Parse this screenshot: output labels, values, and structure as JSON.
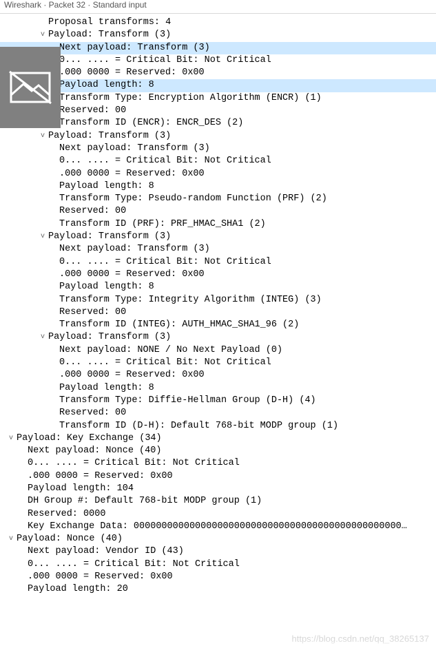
{
  "window": {
    "title": "Wireshark · Packet 32 · Standard input"
  },
  "watermark": "https://blog.csdn.net/qq_38265137",
  "rows": [
    {
      "indent": 56,
      "toggle": "",
      "sel": false,
      "text": "Proposal transforms: 4"
    },
    {
      "indent": 56,
      "toggle": "v",
      "sel": false,
      "text": "Payload: Transform (3)"
    },
    {
      "indent": 72,
      "toggle": "",
      "sel": true,
      "text": "Next payload: Transform (3)"
    },
    {
      "indent": 72,
      "toggle": "",
      "sel": false,
      "text": "0... .... = Critical Bit: Not Critical"
    },
    {
      "indent": 72,
      "toggle": "",
      "sel": false,
      "text": ".000 0000 = Reserved: 0x00"
    },
    {
      "indent": 72,
      "toggle": "",
      "sel": true,
      "text": "Payload length: 8"
    },
    {
      "indent": 72,
      "toggle": "",
      "sel": false,
      "text": "Transform Type: Encryption Algorithm (ENCR) (1)"
    },
    {
      "indent": 72,
      "toggle": "",
      "sel": false,
      "text": "Reserved: 00"
    },
    {
      "indent": 72,
      "toggle": "",
      "sel": false,
      "text": "Transform ID (ENCR): ENCR_DES (2)"
    },
    {
      "indent": 56,
      "toggle": "v",
      "sel": false,
      "text": "Payload: Transform (3)"
    },
    {
      "indent": 72,
      "toggle": "",
      "sel": false,
      "text": "Next payload: Transform (3)"
    },
    {
      "indent": 72,
      "toggle": "",
      "sel": false,
      "text": "0... .... = Critical Bit: Not Critical"
    },
    {
      "indent": 72,
      "toggle": "",
      "sel": false,
      "text": ".000 0000 = Reserved: 0x00"
    },
    {
      "indent": 72,
      "toggle": "",
      "sel": false,
      "text": "Payload length: 8"
    },
    {
      "indent": 72,
      "toggle": "",
      "sel": false,
      "text": "Transform Type: Pseudo-random Function (PRF) (2)"
    },
    {
      "indent": 72,
      "toggle": "",
      "sel": false,
      "text": "Reserved: 00"
    },
    {
      "indent": 72,
      "toggle": "",
      "sel": false,
      "text": "Transform ID (PRF): PRF_HMAC_SHA1 (2)"
    },
    {
      "indent": 56,
      "toggle": "v",
      "sel": false,
      "text": "Payload: Transform (3)"
    },
    {
      "indent": 72,
      "toggle": "",
      "sel": false,
      "text": "Next payload: Transform (3)"
    },
    {
      "indent": 72,
      "toggle": "",
      "sel": false,
      "text": "0... .... = Critical Bit: Not Critical"
    },
    {
      "indent": 72,
      "toggle": "",
      "sel": false,
      "text": ".000 0000 = Reserved: 0x00"
    },
    {
      "indent": 72,
      "toggle": "",
      "sel": false,
      "text": "Payload length: 8"
    },
    {
      "indent": 72,
      "toggle": "",
      "sel": false,
      "text": "Transform Type: Integrity Algorithm (INTEG) (3)"
    },
    {
      "indent": 72,
      "toggle": "",
      "sel": false,
      "text": "Reserved: 00"
    },
    {
      "indent": 72,
      "toggle": "",
      "sel": false,
      "text": "Transform ID (INTEG): AUTH_HMAC_SHA1_96 (2)"
    },
    {
      "indent": 56,
      "toggle": "v",
      "sel": false,
      "text": "Payload: Transform (3)"
    },
    {
      "indent": 72,
      "toggle": "",
      "sel": false,
      "text": "Next payload: NONE / No Next Payload  (0)"
    },
    {
      "indent": 72,
      "toggle": "",
      "sel": false,
      "text": "0... .... = Critical Bit: Not Critical"
    },
    {
      "indent": 72,
      "toggle": "",
      "sel": false,
      "text": ".000 0000 = Reserved: 0x00"
    },
    {
      "indent": 72,
      "toggle": "",
      "sel": false,
      "text": "Payload length: 8"
    },
    {
      "indent": 72,
      "toggle": "",
      "sel": false,
      "text": "Transform Type: Diffie-Hellman Group (D-H) (4)"
    },
    {
      "indent": 72,
      "toggle": "",
      "sel": false,
      "text": "Reserved: 00"
    },
    {
      "indent": 72,
      "toggle": "",
      "sel": false,
      "text": "Transform ID (D-H): Default 768-bit MODP group (1)"
    },
    {
      "indent": 10,
      "toggle": "v",
      "sel": false,
      "text": "Payload: Key Exchange (34)"
    },
    {
      "indent": 26,
      "toggle": "",
      "sel": false,
      "text": "Next payload: Nonce (40)"
    },
    {
      "indent": 26,
      "toggle": "",
      "sel": false,
      "text": "0... .... = Critical Bit: Not Critical"
    },
    {
      "indent": 26,
      "toggle": "",
      "sel": false,
      "text": ".000 0000 = Reserved: 0x00"
    },
    {
      "indent": 26,
      "toggle": "",
      "sel": false,
      "text": "Payload length: 104"
    },
    {
      "indent": 26,
      "toggle": "",
      "sel": false,
      "text": "DH Group #: Default 768-bit MODP group (1)"
    },
    {
      "indent": 26,
      "toggle": "",
      "sel": false,
      "text": "Reserved: 0000"
    },
    {
      "indent": 26,
      "toggle": "",
      "sel": false,
      "text": "Key Exchange Data: 000000000000000000000000000000000000000000000000…"
    },
    {
      "indent": 10,
      "toggle": "v",
      "sel": false,
      "text": "Payload: Nonce (40)"
    },
    {
      "indent": 26,
      "toggle": "",
      "sel": false,
      "text": "Next payload: Vendor ID (43)"
    },
    {
      "indent": 26,
      "toggle": "",
      "sel": false,
      "text": "0... .... = Critical Bit: Not Critical"
    },
    {
      "indent": 26,
      "toggle": "",
      "sel": false,
      "text": ".000 0000 = Reserved: 0x00"
    },
    {
      "indent": 26,
      "toggle": "",
      "sel": false,
      "text": "Payload length: 20"
    }
  ]
}
